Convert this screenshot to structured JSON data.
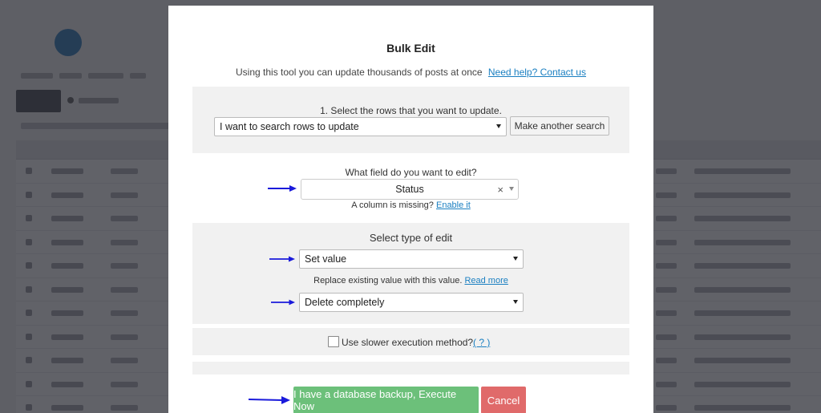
{
  "modal": {
    "title": "Bulk Edit",
    "description": "Using this tool you can update thousands of posts at once",
    "help_link": "Need help? Contact us"
  },
  "rows_section": {
    "label": "1. Select the rows that you want to update.",
    "select_value": "I want to search rows to update",
    "search_button": "Make another search"
  },
  "field_section": {
    "label": "What field do you want to edit?",
    "select_value": "Status",
    "clear_symbol": "×",
    "missing_text": "A column is missing?",
    "enable_link": "Enable it"
  },
  "edit_type_section": {
    "label": "Select type of edit",
    "type_value": "Set value",
    "hint_text": "Replace existing value with this value.",
    "read_more_link": "Read more",
    "value_select": "Delete completely"
  },
  "execution": {
    "checkbox_label": "Use slower execution method?",
    "help_link": "( ? )",
    "checked": false
  },
  "actions": {
    "execute_label": "I have a database backup, Execute Now",
    "cancel_label": "Cancel"
  },
  "colors": {
    "arrow": "#1a1adb",
    "primary": "#6cc07a",
    "cancel": "#e06a6a",
    "link": "#1a7fc1"
  }
}
